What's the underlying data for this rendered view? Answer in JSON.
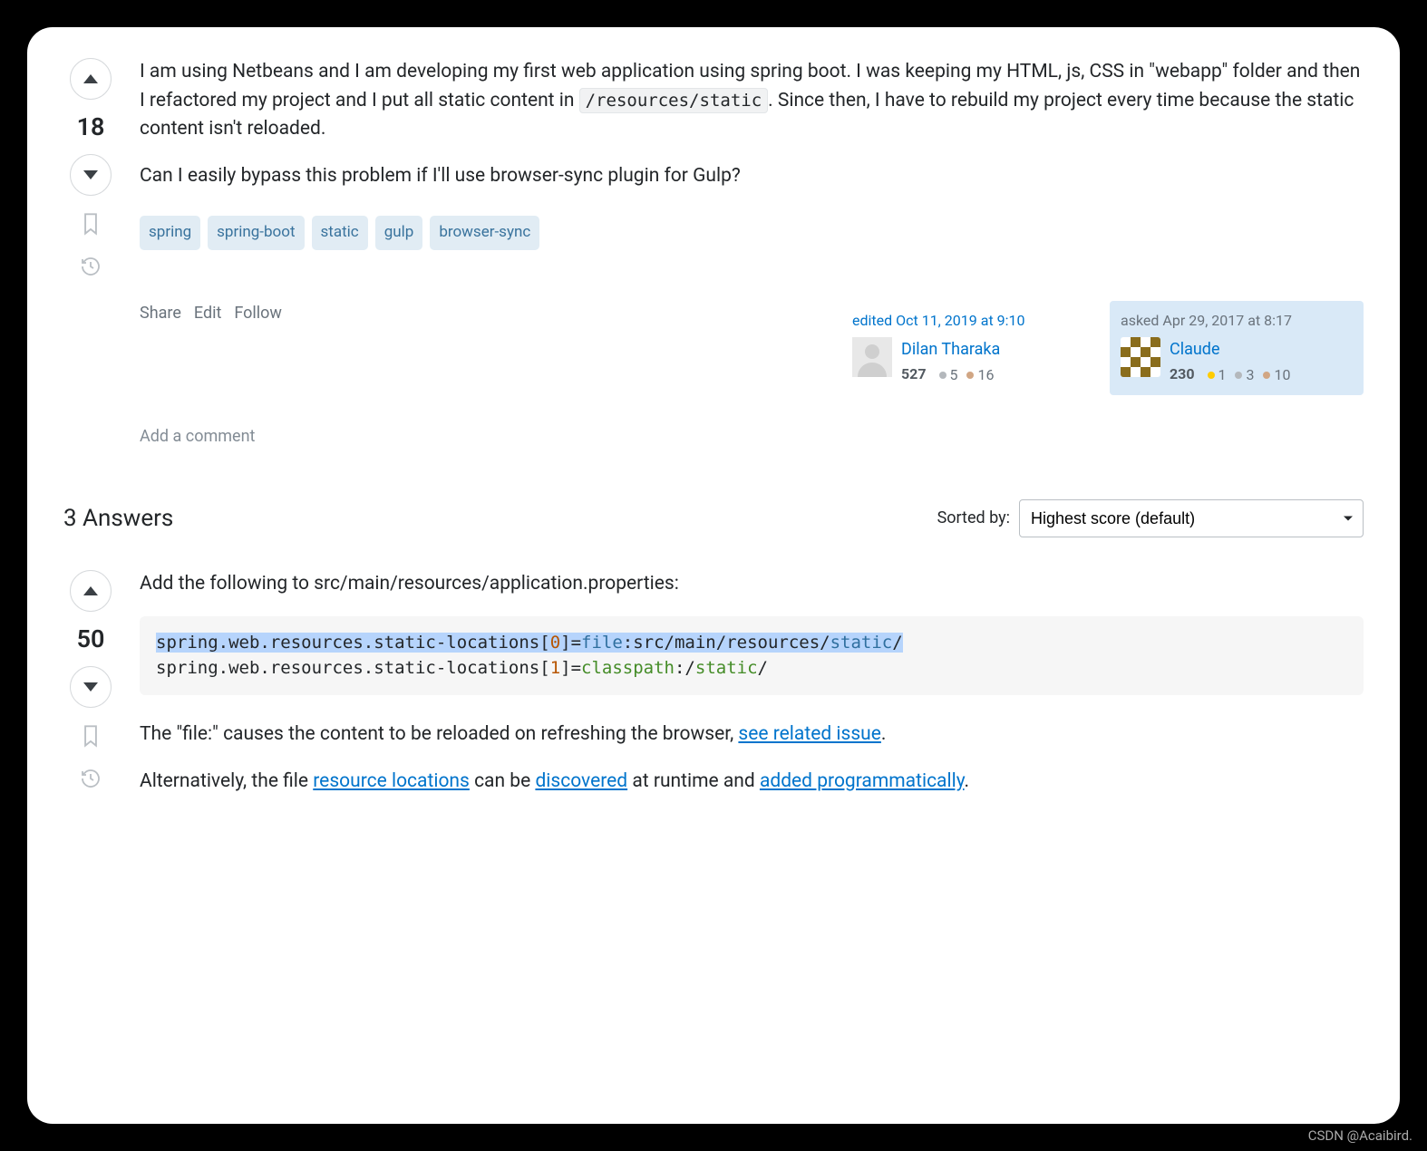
{
  "question": {
    "votes": "18",
    "body": {
      "p1_a": "I am using Netbeans and I am developing my first web application using spring boot. I was keeping my HTML, js, CSS in \"webapp\" folder and then I refactored my project and I put all static content in ",
      "p1_code": "/resources/static",
      "p1_b": ". Since then, I have to rebuild my project every time because the static content isn't reloaded.",
      "p2": "Can I easily bypass this problem if I'll use browser-sync plugin for Gulp?"
    },
    "tags": [
      "spring",
      "spring-boot",
      "static",
      "gulp",
      "browser-sync"
    ],
    "actions": {
      "share": "Share",
      "edit": "Edit",
      "follow": "Follow"
    },
    "editor": {
      "action": "edited Oct 11, 2019 at 9:10",
      "name": "Dilan Tharaka",
      "rep": "527",
      "badges": {
        "silver": "5",
        "bronze": "16"
      }
    },
    "asker": {
      "action": "asked Apr 29, 2017 at 8:17",
      "name": "Claude",
      "rep": "230",
      "badges": {
        "gold": "1",
        "silver": "3",
        "bronze": "10"
      }
    },
    "add_comment": "Add a comment"
  },
  "answers_header": {
    "title": "3 Answers",
    "sorted_by_label": "Sorted by:",
    "sort_value": "Highest score (default)"
  },
  "answer": {
    "votes": "50",
    "p1": "Add the following to src/main/resources/application.properties:",
    "code": {
      "l1a": "spring.web.resources.static-locations[",
      "l1n": "0",
      "l1b": "]=",
      "l1k": "file",
      "l1c": ":src/main/resources/",
      "l1s": "static",
      "l1d": "/",
      "l2a": "spring.web.resources.static-locations[",
      "l2n": "1",
      "l2b": "]=",
      "l2k": "classpath",
      "l2c": ":/",
      "l2s": "static",
      "l2d": "/"
    },
    "p2a": "The \"file:\" causes the content to be reloaded on refreshing the browser, ",
    "p2link": "see related issue",
    "p2b": ".",
    "p3a": "Alternatively, the file ",
    "p3l1": "resource locations",
    "p3b": " can be ",
    "p3l2": "discovered",
    "p3c": " at runtime and ",
    "p3l3": "added programmatically",
    "p3d": "."
  },
  "watermark": "CSDN @Acaibird."
}
